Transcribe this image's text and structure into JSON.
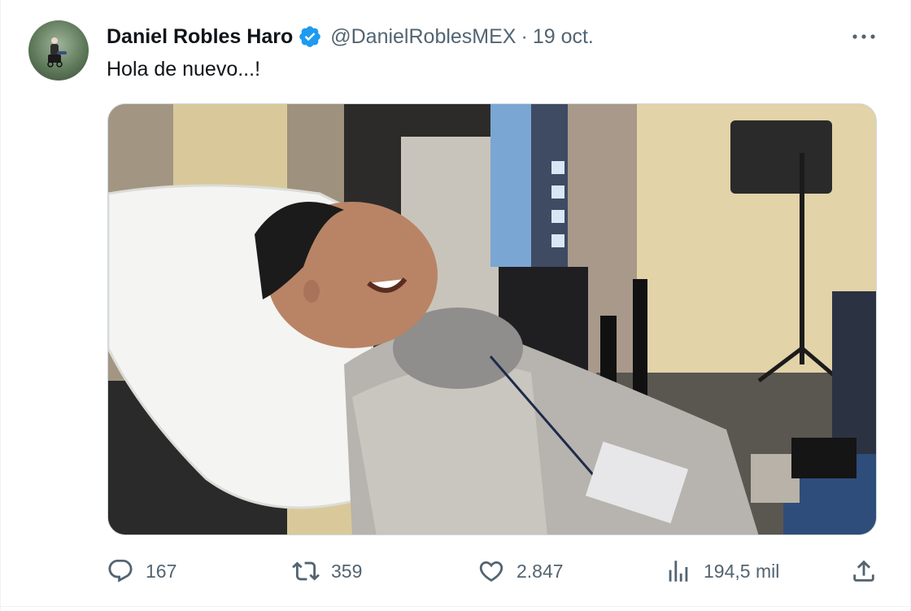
{
  "author": {
    "name": "Daniel Robles Haro",
    "handle": "@DanielRoblesMEX",
    "separator": "·",
    "date": "19 oct.",
    "verified_icon": "verified-badge-icon"
  },
  "tweet": {
    "text": "Hola de nuevo...!"
  },
  "actions": {
    "replies": {
      "icon": "reply-icon",
      "count": "167"
    },
    "retweets": {
      "icon": "retweet-icon",
      "count": "359"
    },
    "likes": {
      "icon": "heart-icon",
      "count": "2.847"
    },
    "views": {
      "icon": "views-icon",
      "count": "194,5 mil"
    },
    "share": {
      "icon": "share-icon"
    }
  },
  "colors": {
    "text_primary": "#0f1419",
    "text_secondary": "#536471",
    "verified_blue": "#1d9bf0",
    "border": "#cfd9de"
  }
}
